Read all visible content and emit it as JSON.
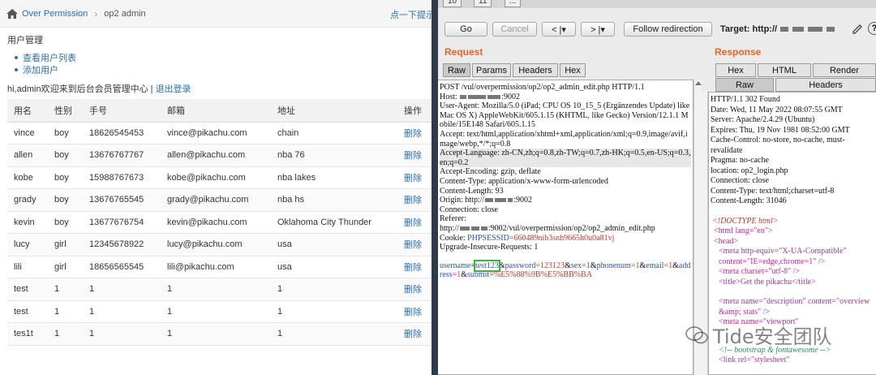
{
  "left": {
    "breadcrumb": {
      "root": "Over Permission",
      "sep": "›",
      "current": "op2 admin",
      "hint": "点一下提示~"
    },
    "section_title": "用户管理",
    "menu": [
      "查看用户列表",
      "添加用户"
    ],
    "welcome": "hi,admin欢迎来到后台会员管理中心 |",
    "logout": "退出登录",
    "table": {
      "headers": [
        "用名",
        "性别",
        "手号",
        "邮箱",
        "地址",
        "操作"
      ],
      "rows": [
        [
          "vince",
          "boy",
          "18626545453",
          "vince@pikachu.com",
          "chain",
          "删除"
        ],
        [
          "allen",
          "boy",
          "13676767767",
          "allen@pikachu.com",
          "nba 76",
          "删除"
        ],
        [
          "kobe",
          "boy",
          "15988767673",
          "kobe@pikachu.com",
          "nba lakes",
          "删除"
        ],
        [
          "grady",
          "boy",
          "13676765545",
          "grady@pikachu.com",
          "nba hs",
          "删除"
        ],
        [
          "kevin",
          "boy",
          "13677676754",
          "kevin@pikachu.com",
          "Oklahoma City Thunder",
          "删除"
        ],
        [
          "lucy",
          "girl",
          "12345678922",
          "lucy@pikachu.com",
          "usa",
          "删除"
        ],
        [
          "lili",
          "girl",
          "18656565545",
          "lili@pikachu.com",
          "usa",
          "删除"
        ],
        [
          "test",
          "1",
          "1",
          "1",
          "1",
          "删除"
        ],
        [
          "test",
          "1",
          "1",
          "1",
          "1",
          "删除"
        ],
        [
          "tes1t",
          "1",
          "1",
          "1",
          "1",
          "删除"
        ]
      ]
    }
  },
  "burp": {
    "tabs": [
      "10",
      "11",
      "..."
    ],
    "buttons": {
      "go": "Go",
      "cancel": "Cancel",
      "back": "< |▾",
      "forward": "> |▾",
      "follow": "Follow redirection"
    },
    "target_label": "Target: http://",
    "help": "?",
    "request": {
      "heading": "Request",
      "tabs": [
        "Raw",
        "Params",
        "Headers",
        "Hex"
      ],
      "lines": [
        "POST /vul/overpermission/op2/op2_admin_edit.php HTTP/1.1",
        "Host: ",
        ":9002",
        "User-Agent: Mozilla/5.0 (iPad; CPU OS 10_15_5 (Ergänzendes Update) like Mac OS X) AppleWebKit/605.1.15 (KHTML, like Gecko) Version/12.1.1 Mobile/15E148 Safari/605.1.15",
        "Accept: text/html,application/xhtml+xml,application/xml;q=0.9,image/avif,image/webp,*/*;q=0.8",
        "Accept-Language: zh-CN,zh;q=0.8,zh-TW;q=0.7,zh-HK;q=0.5,en-US;q=0.3,en;q=0.2",
        "Accept-Encoding: gzip, deflate",
        "Content-Type: application/x-www-form-urlencoded",
        "Content-Length: 93",
        "Origin: http://",
        ":9002",
        "Connection: close",
        "Referer:",
        "http://",
        ":9002/vul/overpermission/op2/op2_admin_edit.php",
        "Cookie: ",
        "PHPSESSID",
        "=660489nib3snh9665h0u0a81vj",
        "Upgrade-Insecure-Requests: 1"
      ],
      "body": {
        "username_key": "username",
        "username_val": "test123",
        "rest": [
          [
            "&",
            "password",
            "=123123"
          ],
          [
            "&",
            "sex",
            "=1"
          ],
          [
            "&",
            "phonenum",
            "=1"
          ],
          [
            "&",
            "email",
            "=1"
          ],
          [
            "&",
            "address",
            "=1"
          ],
          [
            "&",
            "submit",
            "=%E5%88%9B%E5%BB%BA"
          ]
        ]
      }
    },
    "response": {
      "heading": "Response",
      "tabs_top": [
        "Hex",
        "HTML",
        "Render"
      ],
      "tabs_bottom": [
        "Raw",
        "Headers"
      ],
      "headers": [
        "HTTP/1.1 302 Found",
        "Date: Wed, 11 May 2022 08:07:55 GMT",
        "Server: Apache/2.4.29 (Ubuntu)",
        "Expires: Thu, 19 Nov 1981 08:52:00 GMT",
        "Cache-Control: no-store, no-cache, must-revalidate",
        "Pragma: no-cache",
        "location: op2_login.php",
        "Connection: close",
        "Content-Type: text/html;charset=utf-8",
        "Content-Length: 31046"
      ],
      "html": {
        "doctype": "<!DOCTYPE html>",
        "html_open": "<html lang=\"en\">",
        "head_open": "<head>",
        "meta1": "<meta http-equiv=\"X-UA-Compatible\" content=\"IE=edge,chrome=1\" />",
        "meta2": "<meta charset=\"utf-8\" />",
        "title": "<title>Get the pikachu</title>",
        "meta3": "<meta name=\"description\" content=\"overview &amp; stats\" />",
        "meta4": "<meta name=\"viewport\"",
        "comment": "<!-- bootstrap & fontawesome -->",
        "link": "<link rel=\"stylesheet\""
      }
    },
    "watermark": "Tide安全团队"
  }
}
